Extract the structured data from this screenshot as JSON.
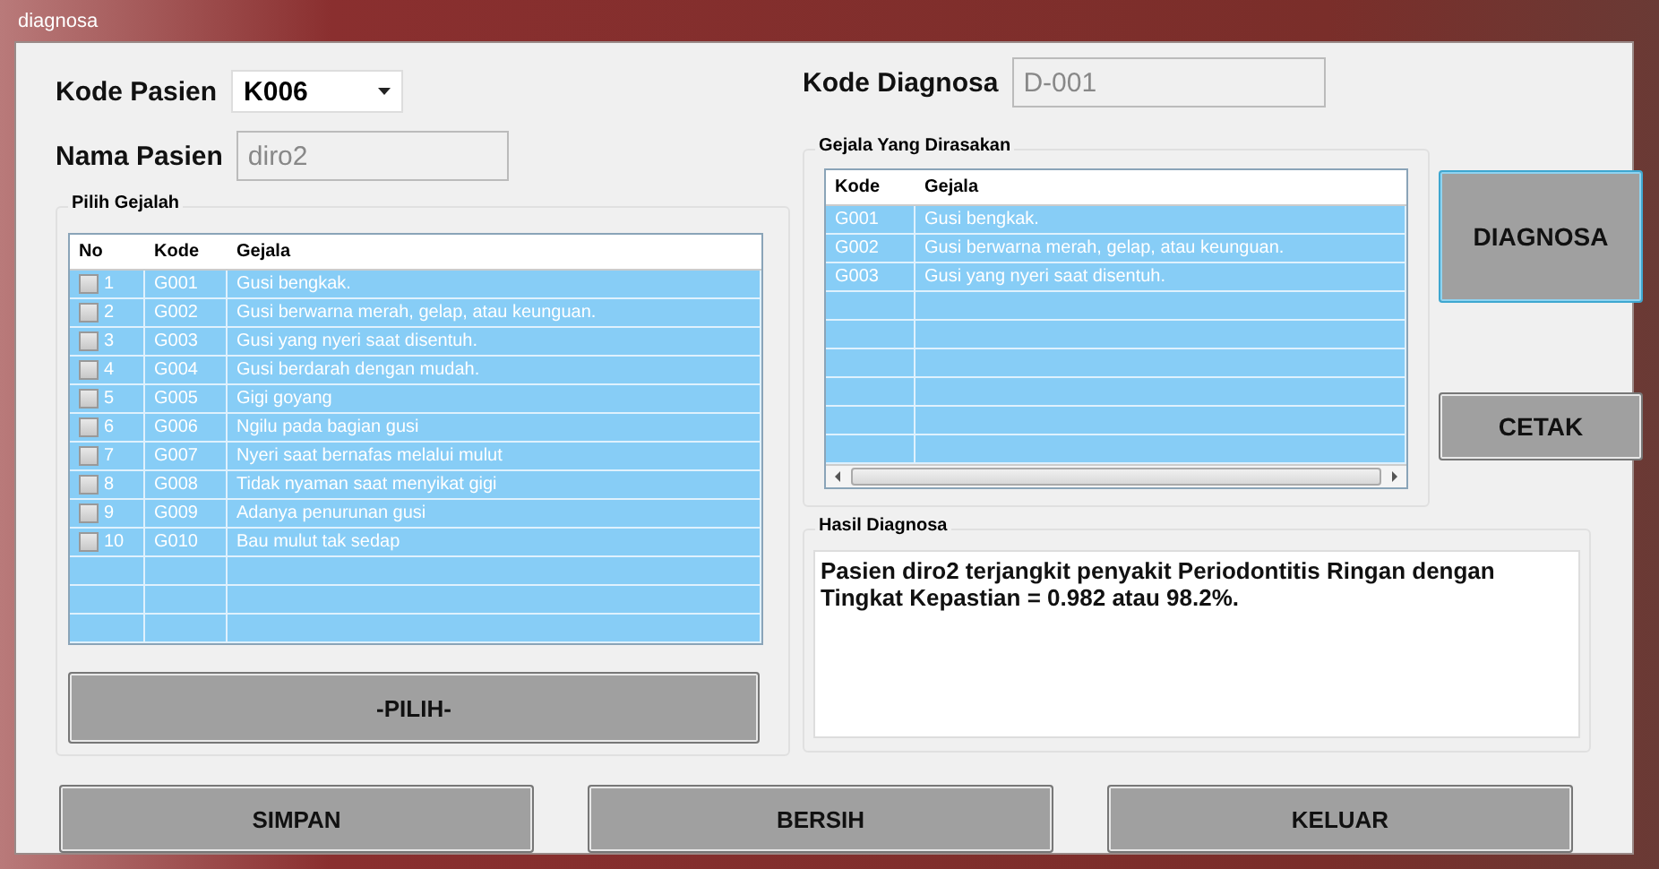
{
  "window": {
    "title": "diagnosa"
  },
  "patient": {
    "code_label": "Kode Pasien",
    "code_value": "K006",
    "name_label": "Nama Pasien",
    "name_value": "diro2"
  },
  "diagnosis_code": {
    "label": "Kode Diagnosa",
    "value": "D-001"
  },
  "symptom_picker": {
    "title": "Pilih Gejalah",
    "columns": [
      "No",
      "Kode",
      "Gejala"
    ],
    "rows": [
      {
        "no": "1",
        "code": "G001",
        "symptom": "Gusi bengkak.",
        "checked": false
      },
      {
        "no": "2",
        "code": "G002",
        "symptom": "Gusi berwarna merah, gelap, atau keunguan.",
        "checked": false
      },
      {
        "no": "3",
        "code": "G003",
        "symptom": "Gusi yang nyeri saat disentuh.",
        "checked": false
      },
      {
        "no": "4",
        "code": "G004",
        "symptom": "Gusi berdarah dengan mudah.",
        "checked": false
      },
      {
        "no": "5",
        "code": "G005",
        "symptom": "Gigi goyang",
        "checked": false
      },
      {
        "no": "6",
        "code": "G006",
        "symptom": "Ngilu pada bagian gusi",
        "checked": false
      },
      {
        "no": "7",
        "code": "G007",
        "symptom": "Nyeri saat bernafas melalui mulut",
        "checked": false
      },
      {
        "no": "8",
        "code": "G008",
        "symptom": "Tidak nyaman saat menyikat gigi",
        "checked": false
      },
      {
        "no": "9",
        "code": "G009",
        "symptom": "Adanya penurunan gusi",
        "checked": false
      },
      {
        "no": "10",
        "code": "G010",
        "symptom": "Bau mulut tak sedap",
        "checked": false
      }
    ],
    "button": "-PILIH-"
  },
  "felt_symptoms": {
    "title": "Gejala Yang Dirasakan",
    "columns": [
      "Kode",
      "Gejala"
    ],
    "rows": [
      {
        "code": "G001",
        "symptom": "Gusi bengkak."
      },
      {
        "code": "G002",
        "symptom": "Gusi berwarna merah, gelap, atau keunguan."
      },
      {
        "code": "G003",
        "symptom": "Gusi yang nyeri saat disentuh."
      }
    ]
  },
  "side_buttons": [
    {
      "label": "DIAGNOSA",
      "focused": true
    },
    {
      "label": "CETAK",
      "focused": false
    }
  ],
  "result": {
    "title": "Hasil Diagnosa",
    "text": " Pasien diro2 terjangkit penyakit Periodontitis Ringan dengan Tingkat Kepastian = 0.982 atau 98.2%."
  },
  "bottom_buttons": [
    "SIMPAN",
    "BERSIH",
    "KELUAR"
  ]
}
